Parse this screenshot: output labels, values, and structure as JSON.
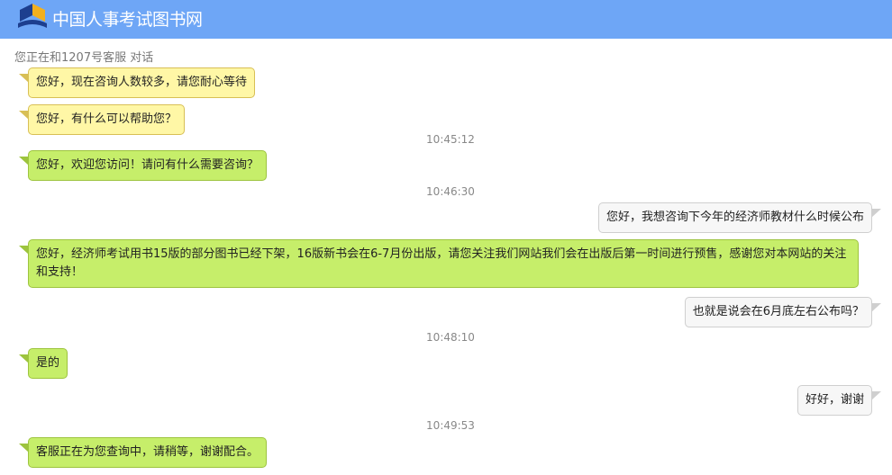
{
  "header": {
    "title": "中国人事考试图书网"
  },
  "status": "您正在和1207号客服 对话",
  "messages": [
    {
      "from": "agent",
      "style": "yellow",
      "text": "您好，现在咨询人数较多，请您耐心等待"
    },
    {
      "from": "agent",
      "style": "yellow",
      "text": "您好，有什么可以帮助您？"
    },
    {
      "time": "10:45:12"
    },
    {
      "from": "agent",
      "style": "green",
      "text": "您好，欢迎您访问！请问有什么需要咨询？"
    },
    {
      "time": "10:46:30"
    },
    {
      "from": "user",
      "text": "您好，我想咨询下今年的经济师教材什么时候公布"
    },
    {
      "from": "agent",
      "style": "green",
      "text": "您好，经济师考试用书15版的部分图书已经下架，16版新书会在6-7月份出版，请您关注我们网站我们会在出版后第一时间进行预售，感谢您对本网站的关注和支持！"
    },
    {
      "from": "user",
      "text": "也就是说会在6月底左右公布吗？"
    },
    {
      "time": "10:48:10"
    },
    {
      "from": "agent",
      "style": "green",
      "text": "是的"
    },
    {
      "from": "user",
      "text": "好好，谢谢"
    },
    {
      "time": "10:49:53"
    },
    {
      "from": "agent",
      "style": "green",
      "text": "客服正在为您查询中，请稍等，谢谢配合。"
    }
  ]
}
